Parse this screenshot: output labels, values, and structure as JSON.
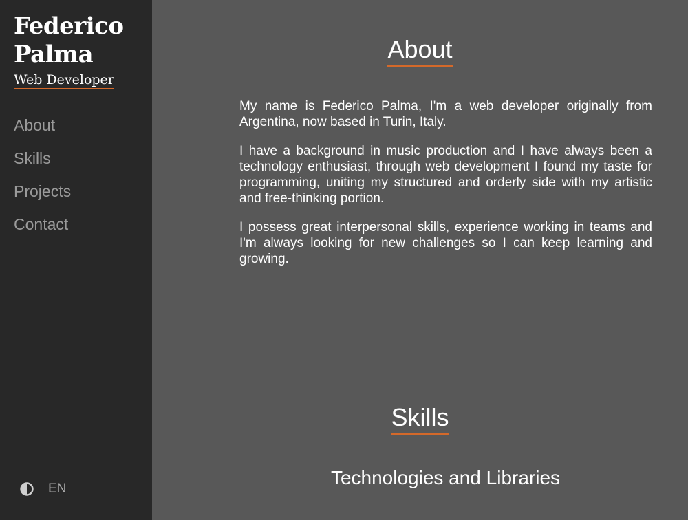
{
  "sidebar": {
    "name": "Federico Palma",
    "role": "Web Developer",
    "nav": [
      "About",
      "Skills",
      "Projects",
      "Contact"
    ],
    "theme_icon": "contrast-icon",
    "language": "EN"
  },
  "about": {
    "title": "About",
    "paragraphs": [
      "My name is Federico Palma, I'm a web developer originally from Argentina, now based in Turin, Italy.",
      "I have a background in music production and I have always been a technology enthusiast, through web development I found my taste for programming, uniting my structured and orderly side with my artistic and free-thinking portion.",
      "I possess great interpersonal skills, experience working in teams and I'm always looking for new challenges so I can keep learning and growing."
    ]
  },
  "skills": {
    "title": "Skills",
    "subtitle": "Technologies and Libraries"
  },
  "colors": {
    "accent": "#d4692a",
    "sidebar_bg": "#282828",
    "main_bg": "#585858"
  }
}
